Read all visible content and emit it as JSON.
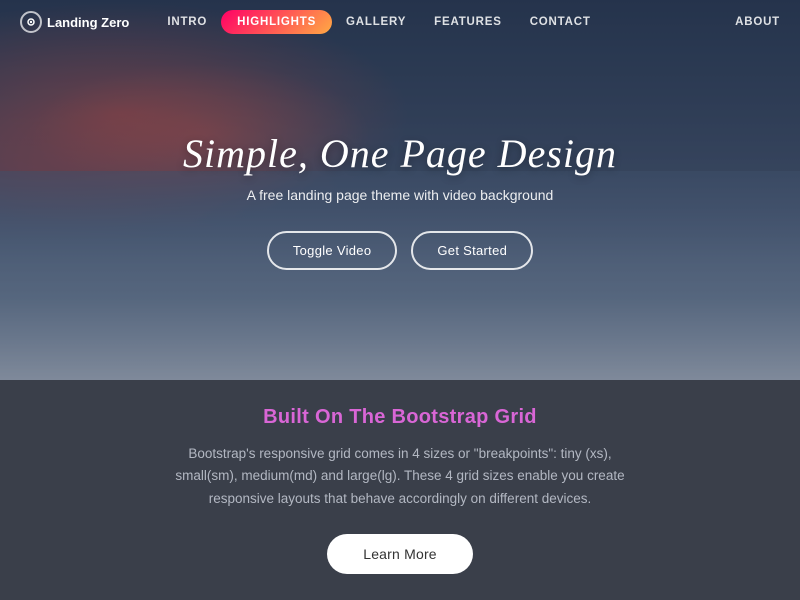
{
  "nav": {
    "brand": "Landing Zero",
    "links": [
      {
        "label": "INTRO",
        "active": false
      },
      {
        "label": "HIGHLIGHTS",
        "active": true
      },
      {
        "label": "GALLERY",
        "active": false
      },
      {
        "label": "FEATURES",
        "active": false
      },
      {
        "label": "CONTACT",
        "active": false
      }
    ],
    "about": "ABOUT"
  },
  "hero": {
    "title": "Simple, One Page Design",
    "subtitle": "A free landing page theme with video background",
    "button_toggle": "Toggle Video",
    "button_start": "Get Started"
  },
  "section": {
    "title": "Built On The Bootstrap Grid",
    "text": "Bootstrap's responsive grid comes in 4 sizes or \"breakpoints\": tiny (xs), small(sm), medium(md) and large(lg). These 4 grid sizes enable you create responsive layouts that behave accordingly on different devices.",
    "button_learn": "Learn More"
  }
}
